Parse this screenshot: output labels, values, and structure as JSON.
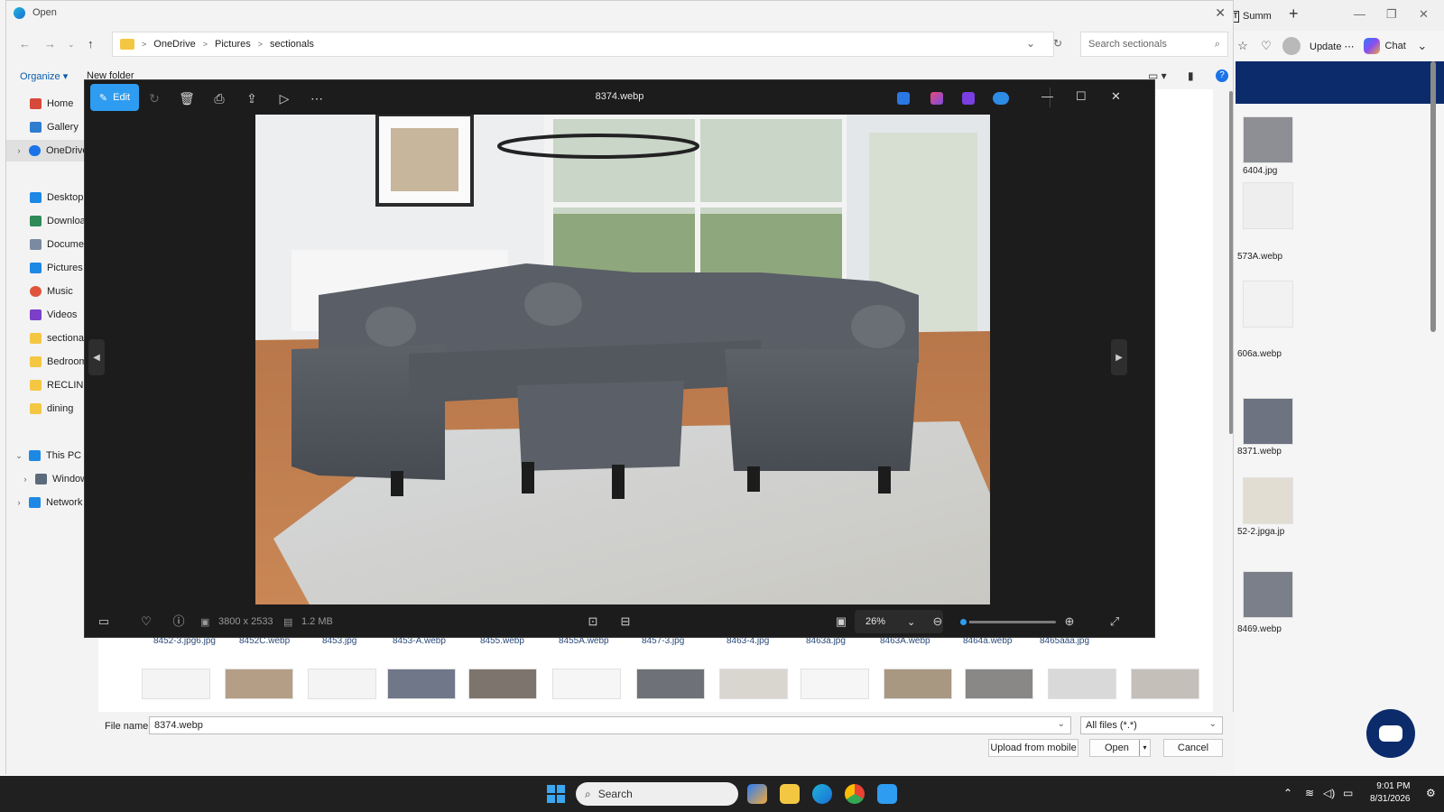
{
  "browser": {
    "tab_label": "Summ",
    "tab_favicon": "TT",
    "update_label": "Update",
    "chat_label": "Chat"
  },
  "dialog": {
    "title": "Open",
    "breadcrumb": [
      "OneDrive",
      "Pictures",
      "sectionals"
    ],
    "search_placeholder": "Search sectionals",
    "organize_label": "Organize",
    "new_folder_label": "New folder",
    "nav": [
      {
        "label": "Home",
        "icon": "home-icon",
        "color": "#d6493a"
      },
      {
        "label": "Gallery",
        "icon": "gallery-icon",
        "color": "#2f7dd1"
      },
      {
        "label": "OneDrive",
        "icon": "onedrive-icon",
        "color": "#1a73e8"
      },
      {
        "label": "Desktop",
        "icon": "desktop-icon",
        "color": "#1e88e5"
      },
      {
        "label": "Downloads",
        "icon": "downloads-icon",
        "color": "#2e8b57"
      },
      {
        "label": "Documents",
        "icon": "documents-icon",
        "color": "#7a8aa0"
      },
      {
        "label": "Pictures",
        "icon": "pictures-icon",
        "color": "#1e88e5"
      },
      {
        "label": "Music",
        "icon": "music-icon",
        "color": "#e0543c"
      },
      {
        "label": "Videos",
        "icon": "videos-icon",
        "color": "#7b3fc9"
      },
      {
        "label": "sectionals",
        "icon": "folder-icon",
        "color": "#f4c742"
      },
      {
        "label": "Bedroom",
        "icon": "folder-icon",
        "color": "#f4c742"
      },
      {
        "label": "RECLINERS",
        "icon": "folder-icon",
        "color": "#f4c742"
      },
      {
        "label": "dining",
        "icon": "folder-icon",
        "color": "#f4c742"
      },
      {
        "label": "This PC",
        "icon": "pc-icon",
        "color": "#1e88e5"
      },
      {
        "label": "Windows (C:)",
        "icon": "drive-icon",
        "color": "#5b6b7c"
      },
      {
        "label": "Network",
        "icon": "network-icon",
        "color": "#1e88e5"
      }
    ],
    "right_files": [
      "6404.jpg",
      "573A.webp",
      "606a.webp",
      "8371.webp",
      "52-2.jpga.jp",
      "8469.webp"
    ],
    "bottom_files": [
      "8452-3.jpg6.jpg",
      "8452C.webp",
      "8453.jpg",
      "8453-A.webp",
      "8455.webp",
      "8455A.webp",
      "8457-3.jpg",
      "8463-4.jpg",
      "8463a.jpg",
      "8463A.webp",
      "8464a.webp",
      "8465aaa.jpg"
    ],
    "file_name_label": "File name:",
    "file_name_value": "8374.webp",
    "file_type": "All files (*.*)",
    "upload_label": "Upload from mobile",
    "open_label": "Open",
    "cancel_label": "Cancel"
  },
  "viewer": {
    "edit_label": "Edit",
    "title": "8374.webp",
    "dimensions": "3800 x 2533",
    "size": "1.2 MB",
    "zoom": "26%",
    "zoom_fraction": 0.05
  },
  "taskbar": {
    "search_label": "Search",
    "time": "9:01 PM",
    "date": "8/31/2026"
  }
}
